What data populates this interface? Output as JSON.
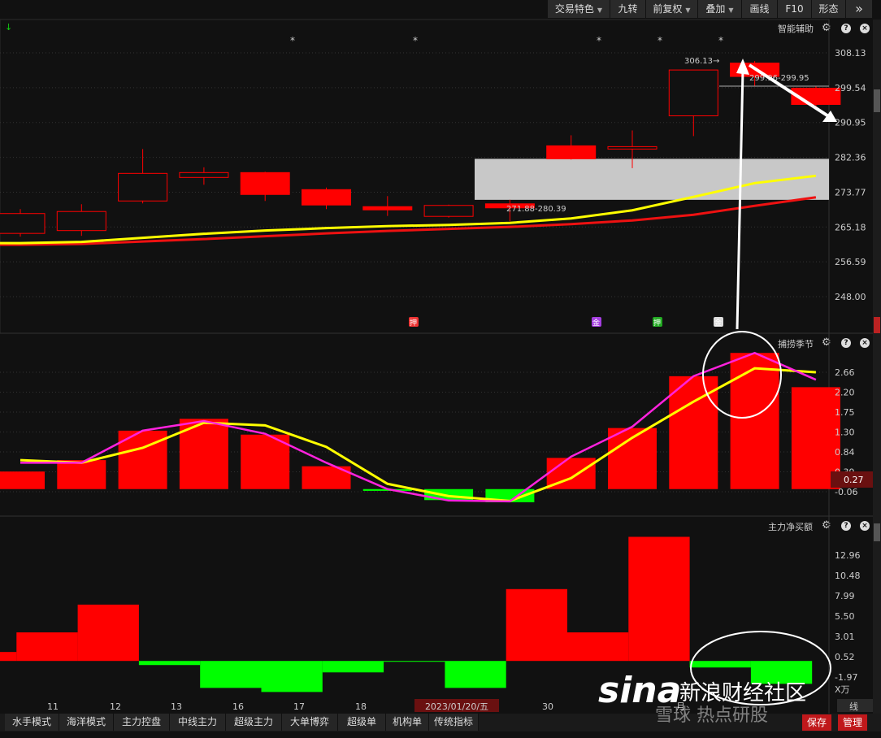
{
  "toolbar": {
    "items": [
      {
        "label": "交易特色",
        "dropdown": true
      },
      {
        "label": "九转",
        "dropdown": false
      },
      {
        "label": "前复权",
        "dropdown": true
      },
      {
        "label": "叠加",
        "dropdown": true
      },
      {
        "label": "画线",
        "dropdown": false
      },
      {
        "label": "F10",
        "dropdown": false
      },
      {
        "label": "形态",
        "dropdown": false
      }
    ],
    "more_icon": "double-chevron-right-icon"
  },
  "main_panel": {
    "title": "智能辅助",
    "y_ticks": [
      "308.13",
      "299.54",
      "290.95",
      "282.36",
      "273.77",
      "265.18",
      "256.59",
      "248.00"
    ],
    "annotations": {
      "high": "306.13→",
      "range1": "299.96-299.95",
      "range2": "271.88-280.39"
    },
    "star_marker": "*",
    "badges": [
      {
        "label": "押",
        "color": "#e33"
      },
      {
        "label": "金",
        "color": "#a53fe0"
      },
      {
        "label": "押",
        "color": "#2a2"
      },
      {
        "label": "金",
        "color": "#ddd"
      }
    ],
    "candles": [
      {
        "o": 263.6,
        "c": 268.5,
        "h": 269.6,
        "l": 262.8
      },
      {
        "o": 264.3,
        "c": 269.0,
        "h": 270.8,
        "l": 263.0
      },
      {
        "o": 271.6,
        "c": 278.4,
        "h": 284.4,
        "l": 271.0
      },
      {
        "o": 277.4,
        "c": 278.6,
        "h": 279.9,
        "l": 275.6
      },
      {
        "o": 278.6,
        "c": 273.2,
        "h": 278.8,
        "l": 271.6
      },
      {
        "o": 274.4,
        "c": 270.6,
        "h": 274.9,
        "l": 269.6
      },
      {
        "o": 270.2,
        "c": 269.4,
        "h": 272.8,
        "l": 267.9
      },
      {
        "o": 267.8,
        "c": 270.5,
        "h": 270.7,
        "l": 267.5
      },
      {
        "o": 270.9,
        "c": 269.9,
        "h": 271.9,
        "l": 266.6
      },
      {
        "o": 285.2,
        "c": 282.0,
        "h": 287.8,
        "l": 281.8
      },
      {
        "o": 284.6,
        "c": 285.0,
        "h": 289.0,
        "l": 279.7
      },
      {
        "o": 292.6,
        "c": 303.9,
        "h": 303.9,
        "l": 287.6
      },
      {
        "o": 305.6,
        "c": 302.3,
        "h": 306.1,
        "l": 300.0
      },
      {
        "o": 299.4,
        "c": 295.4,
        "h": 299.9,
        "l": 294.6
      }
    ],
    "ma_yellow": [
      261.2,
      261.5,
      262.5,
      263.5,
      264.3,
      264.9,
      265.4,
      265.7,
      266.2,
      267.3,
      269.3,
      272.6,
      276.0,
      277.8
    ],
    "ma_red": [
      260.8,
      261.0,
      261.6,
      262.2,
      262.9,
      263.6,
      264.2,
      264.7,
      265.2,
      265.9,
      266.8,
      268.2,
      270.4,
      272.5
    ]
  },
  "mid_panel": {
    "title": "捕捞季节",
    "y_ticks": [
      "2.66",
      "2.20",
      "1.75",
      "1.30",
      "0.84",
      "0.39",
      "-0.06"
    ],
    "current_value": "0.27",
    "bars": [
      0.4,
      0.66,
      1.33,
      1.6,
      1.24,
      0.52,
      -0.04,
      -0.25,
      -0.3,
      0.71,
      1.39,
      2.57,
      3.1,
      2.32
    ],
    "pink": [
      0.6,
      0.6,
      1.33,
      1.55,
      1.26,
      0.6,
      0.0,
      -0.26,
      -0.28,
      0.74,
      1.42,
      2.57,
      3.1,
      2.49
    ],
    "yellow": [
      0.66,
      0.6,
      0.94,
      1.51,
      1.45,
      0.96,
      0.12,
      -0.16,
      -0.27,
      0.25,
      1.17,
      1.99,
      2.75,
      2.66
    ]
  },
  "bottom_panel": {
    "title": "主力净买额",
    "y_ticks": [
      "12.96",
      "10.48",
      "7.99",
      "5.50",
      "3.01",
      "0.52",
      "-1.97"
    ],
    "unit": "X万",
    "bars": [
      1.1,
      3.5,
      6.9,
      -0.5,
      -3.3,
      -3.8,
      -1.4,
      -0.1,
      -3.3,
      8.8,
      3.5,
      15.2,
      -0.8,
      -2.8
    ],
    "x_labels": [
      "11",
      "12",
      "13",
      "16",
      "17",
      "18",
      "2023/01/20/五",
      "30"
    ],
    "x_label_tail": "月",
    "line_tab": "线"
  },
  "bottom_tabs": [
    "水手模式",
    "海洋模式",
    "主力控盘",
    "中线主力",
    "超级主力",
    "大单博弈",
    "超级单",
    "机构单",
    "传统指标"
  ],
  "right_buttons": {
    "save": "保存",
    "manage": "管理"
  },
  "watermark": {
    "logo": "sina",
    "text1": "新浪财经社区",
    "text2": "雪球 热点研股"
  },
  "colors": {
    "up": "#ff0000",
    "down": "#00ff00",
    "ma_yellow": "#ffff00",
    "ma_red": "#ee1111",
    "pink": "#ff22dd",
    "bg": "#111111",
    "box": "#c8c8c8"
  }
}
